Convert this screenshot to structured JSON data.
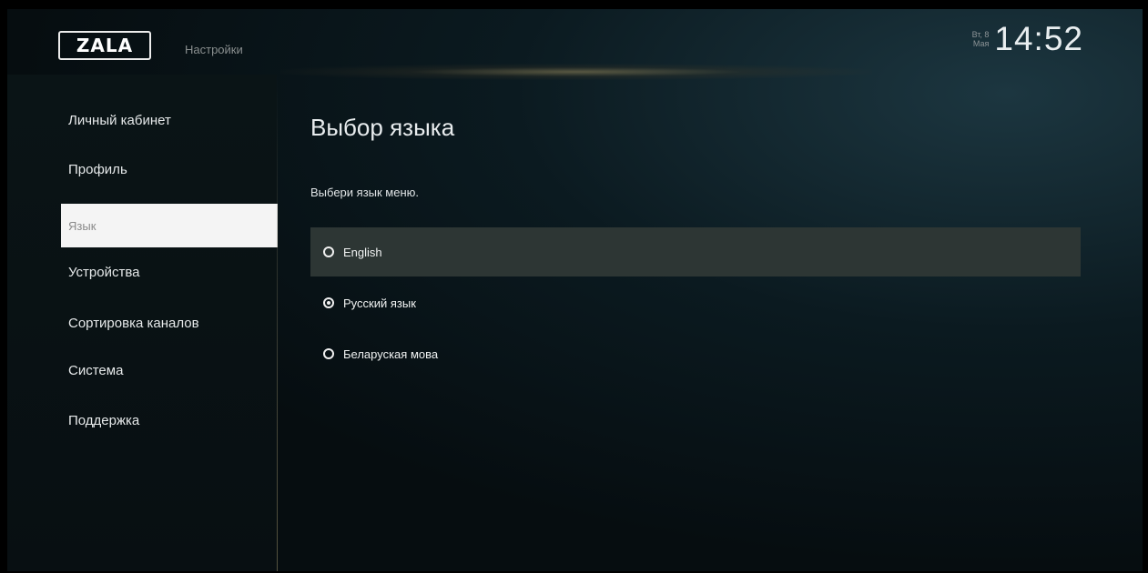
{
  "header": {
    "logo_text": "ZALA",
    "section_title": "Настройки",
    "date_line1": "Вт, 8",
    "date_line2": "Мая",
    "time": "14:52"
  },
  "sidebar": {
    "items": [
      {
        "label": "Личный кабинет",
        "active": false
      },
      {
        "label": "Профиль",
        "active": false
      },
      {
        "label": "Язык",
        "active": true
      },
      {
        "label": "Устройства",
        "active": false
      },
      {
        "label": "Сортировка каналов",
        "active": false
      },
      {
        "label": "Система",
        "active": false
      },
      {
        "label": "Поддержка",
        "active": false
      }
    ]
  },
  "main": {
    "title": "Выбор языка",
    "subtitle": "Выбери язык меню.",
    "options": [
      {
        "label": "English",
        "selected": false,
        "focused": true
      },
      {
        "label": "Русский язык",
        "selected": true,
        "focused": false
      },
      {
        "label": "Беларуская мова",
        "selected": false,
        "focused": false
      }
    ]
  },
  "colors": {
    "active_item_bg": "#f4f4f4",
    "focused_option_bg": "#2d3634",
    "background": "#0b1a20"
  }
}
